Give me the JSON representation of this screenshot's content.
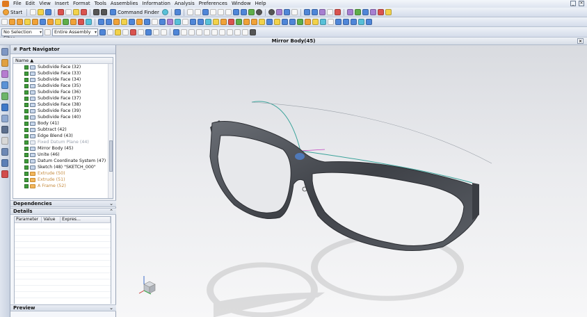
{
  "menu": [
    "File",
    "Edit",
    "View",
    "Insert",
    "Format",
    "Tools",
    "Assemblies",
    "Information",
    "Analysis",
    "Preferences",
    "Window",
    "Help"
  ],
  "toolbar": {
    "start_label": "Start",
    "command_finder_label": "Command Finder"
  },
  "selection": {
    "filter_value": "No Selection Filter",
    "scope_value": "Entire Assembly"
  },
  "viewport": {
    "title": "Mirror Body(45)"
  },
  "navigator": {
    "title": "Part Navigator",
    "column_name": "Name",
    "items": [
      {
        "label": "Subdivide Face (32)",
        "state": "normal"
      },
      {
        "label": "Subdivide Face (33)",
        "state": "normal"
      },
      {
        "label": "Subdivide Face (34)",
        "state": "normal"
      },
      {
        "label": "Subdivide Face (35)",
        "state": "normal"
      },
      {
        "label": "Subdivide Face (36)",
        "state": "normal"
      },
      {
        "label": "Subdivide Face (37)",
        "state": "normal"
      },
      {
        "label": "Subdivide Face (38)",
        "state": "normal"
      },
      {
        "label": "Subdivide Face (39)",
        "state": "normal"
      },
      {
        "label": "Subdivide Face (40)",
        "state": "normal"
      },
      {
        "label": "Body (41)",
        "state": "normal"
      },
      {
        "label": "Subtract (42)",
        "state": "normal"
      },
      {
        "label": "Edge Blend (43)",
        "state": "normal"
      },
      {
        "label": "Fixed Datum Plane (44)",
        "state": "dim"
      },
      {
        "label": "Mirror Body (45)",
        "state": "normal"
      },
      {
        "label": "Unite (46)",
        "state": "normal"
      },
      {
        "label": "Datum Coordinate System (47)",
        "state": "normal"
      },
      {
        "label": "Sketch (48) \"SKETCH_000\"",
        "state": "normal"
      },
      {
        "label": "Extrude (50)",
        "state": "orange"
      },
      {
        "label": "Extrude (51)",
        "state": "orange"
      },
      {
        "label": "A Frame (52)",
        "state": "orange"
      }
    ]
  },
  "sections": {
    "dependencies": "Dependencies",
    "details": "Details",
    "preview": "Preview"
  },
  "details_columns": [
    "Parameter",
    "Value",
    "Expres..."
  ],
  "colors": {
    "accent": "#4f86d8",
    "model": "#4a4d53",
    "curve": "#3aa39a"
  }
}
